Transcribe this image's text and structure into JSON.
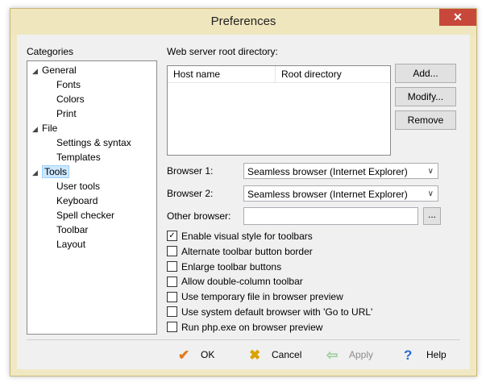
{
  "window": {
    "title": "Preferences",
    "close_glyph": "✕"
  },
  "categories": {
    "label": "Categories",
    "items": [
      {
        "label": "General",
        "level": 0,
        "expanded": true
      },
      {
        "label": "Fonts",
        "level": 1
      },
      {
        "label": "Colors",
        "level": 1
      },
      {
        "label": "Print",
        "level": 1
      },
      {
        "label": "File",
        "level": 0,
        "expanded": true
      },
      {
        "label": "Settings & syntax",
        "level": 1
      },
      {
        "label": "Templates",
        "level": 1
      },
      {
        "label": "Tools",
        "level": 0,
        "expanded": true,
        "selected": true
      },
      {
        "label": "User tools",
        "level": 1
      },
      {
        "label": "Keyboard",
        "level": 1
      },
      {
        "label": "Spell checker",
        "level": 1
      },
      {
        "label": "Toolbar",
        "level": 1
      },
      {
        "label": "Layout",
        "level": 1
      }
    ]
  },
  "webserver": {
    "label": "Web server root directory:",
    "columns": [
      "Host name",
      "Root directory"
    ],
    "add_label": "Add...",
    "modify_label": "Modify...",
    "remove_label": "Remove"
  },
  "browsers": {
    "browser1_label": "Browser 1:",
    "browser1_value": "Seamless browser (Internet Explorer)",
    "browser2_label": "Browser 2:",
    "browser2_value": "Seamless browser (Internet Explorer)",
    "other_label": "Other browser:",
    "other_value": "",
    "browse_label": "..."
  },
  "options": [
    {
      "label": "Enable visual style for toolbars",
      "checked": true
    },
    {
      "label": "Alternate toolbar button border",
      "checked": false
    },
    {
      "label": "Enlarge toolbar buttons",
      "checked": false
    },
    {
      "label": "Allow double-column toolbar",
      "checked": false
    },
    {
      "label": "Use temporary file in browser preview",
      "checked": false
    },
    {
      "label": "Use system default browser with 'Go to URL'",
      "checked": false
    },
    {
      "label": "Run php.exe on browser preview",
      "checked": false
    }
  ],
  "footer": {
    "ok_label": "OK",
    "cancel_label": "Cancel",
    "apply_label": "Apply",
    "help_label": "Help"
  },
  "colors": {
    "ok_icon": "#e07b1a",
    "cancel_icon": "#d9a300",
    "apply_icon": "#9ccc9c",
    "help_icon": "#2a6bd1"
  }
}
